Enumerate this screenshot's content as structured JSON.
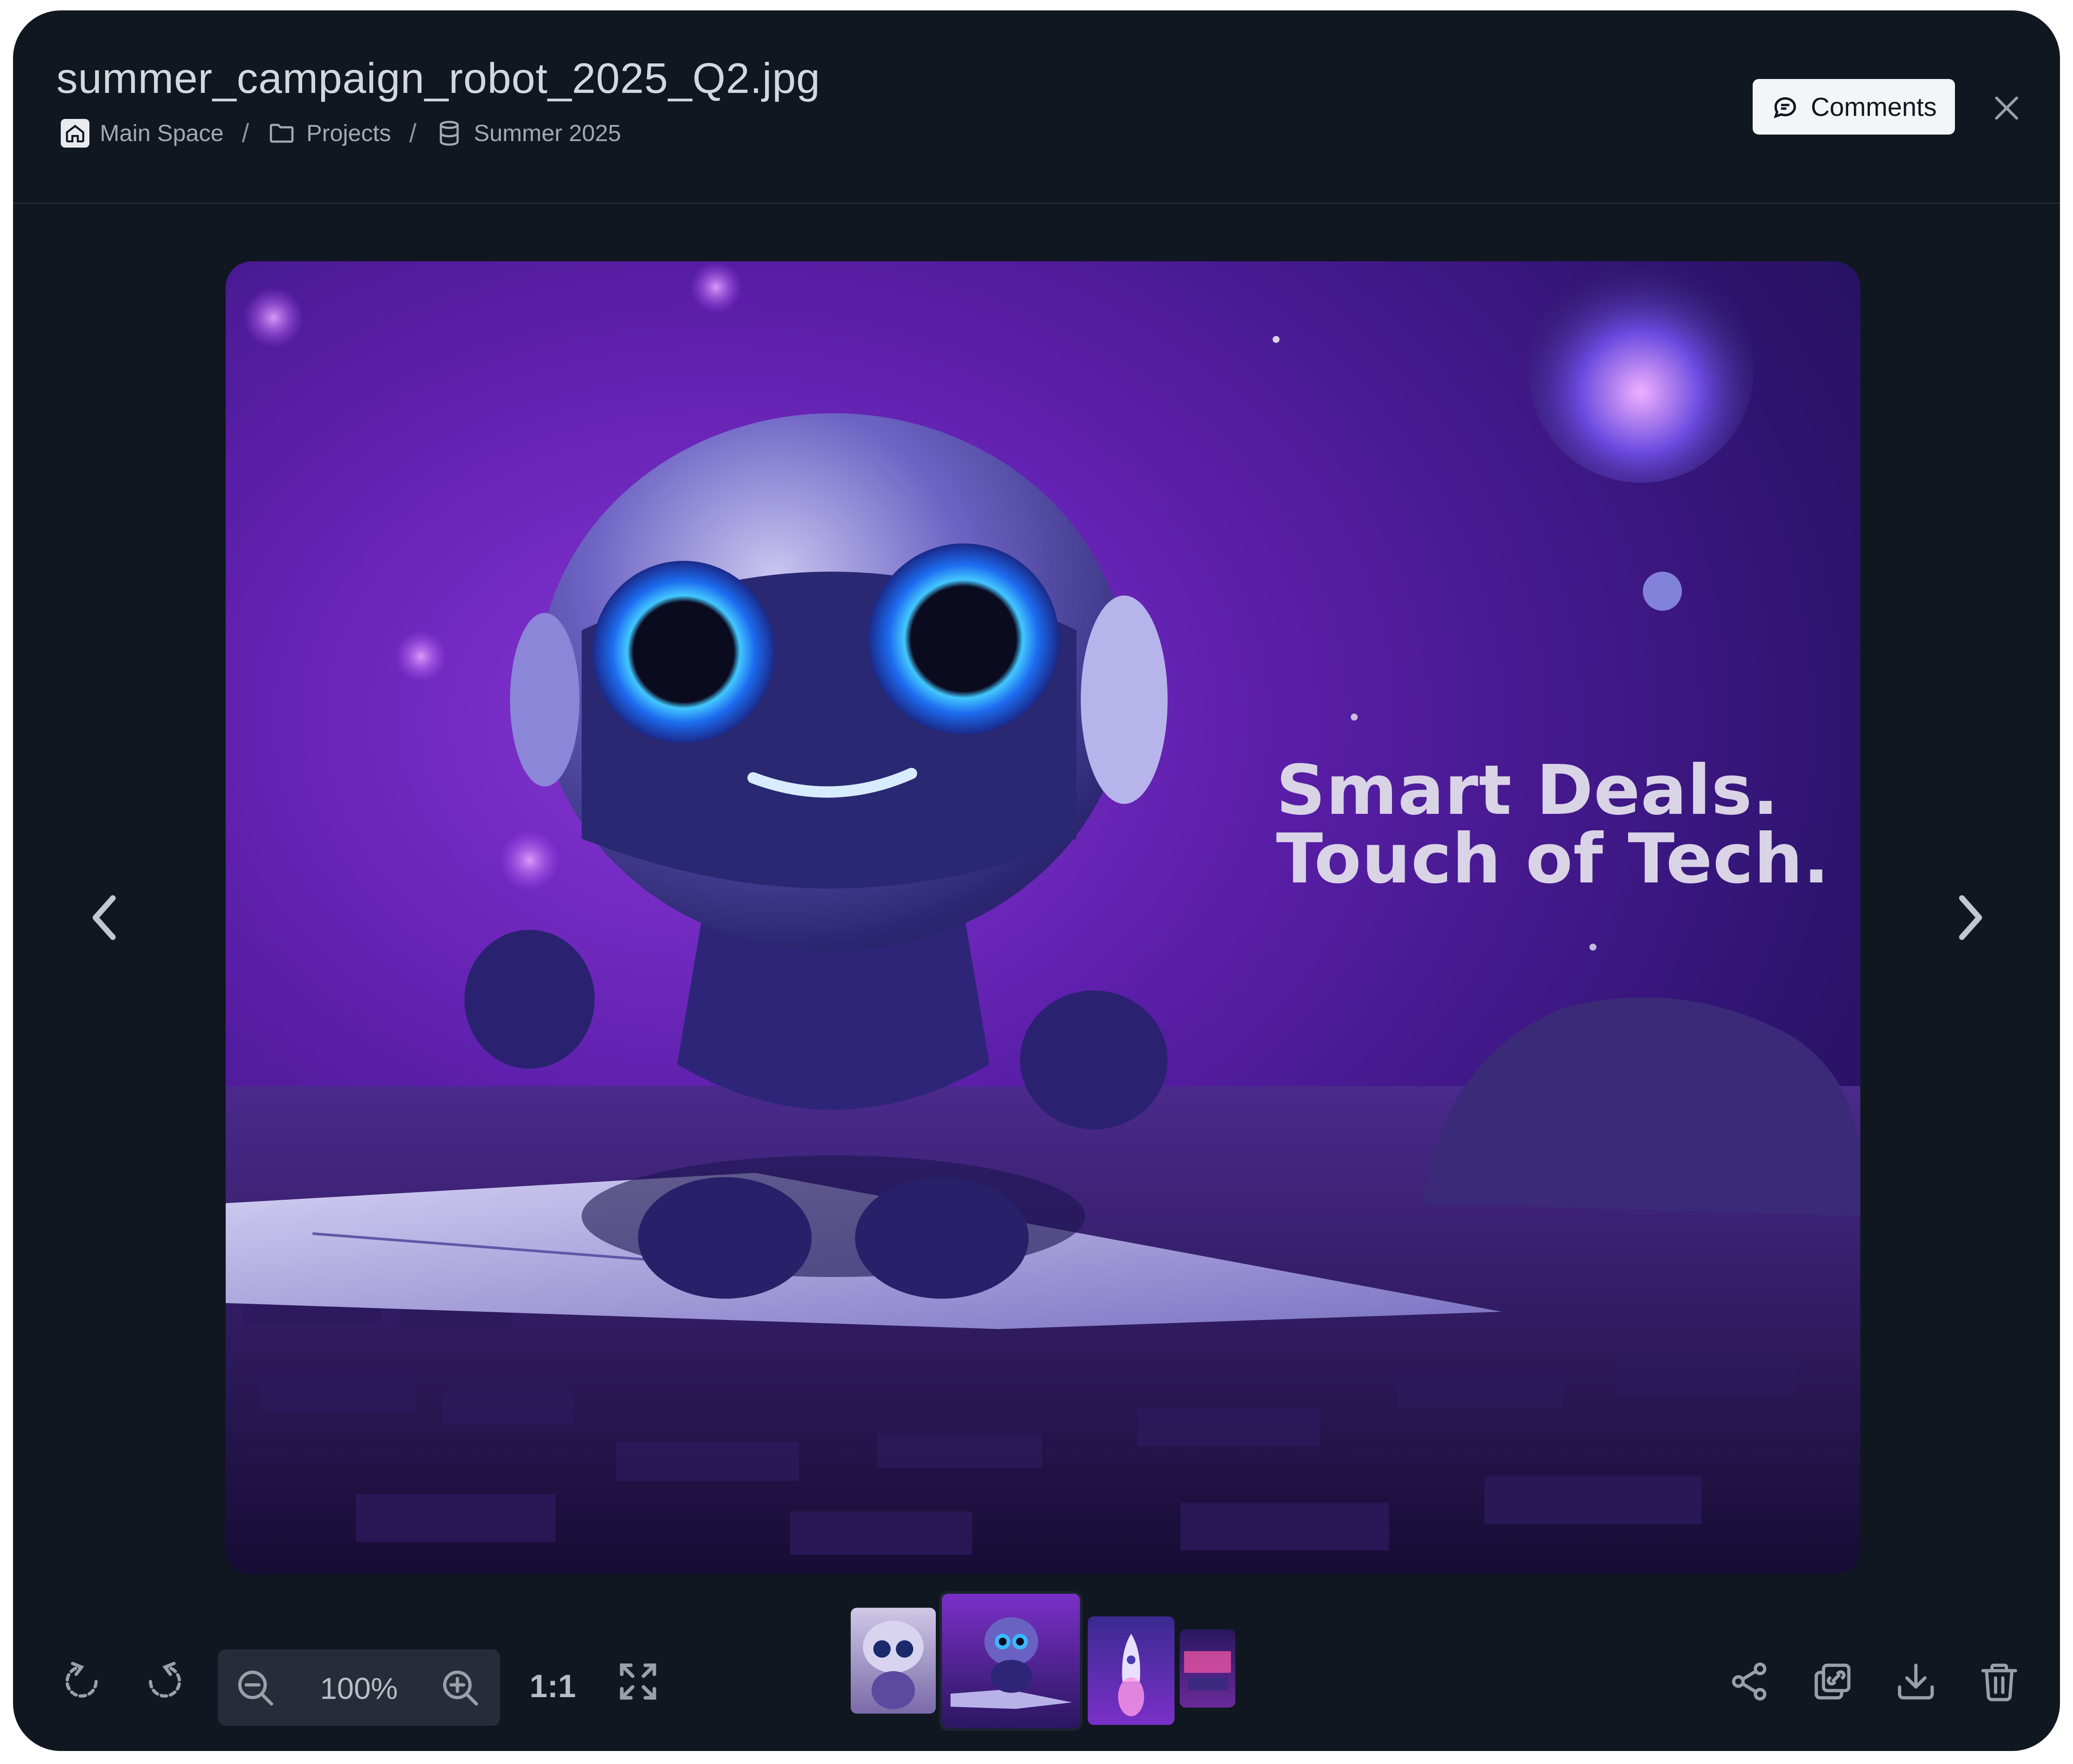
{
  "file": {
    "title": "summer_campaign_robot_2025_Q2.jpg"
  },
  "breadcrumb": [
    {
      "label": "Main Space",
      "icon": "home-icon"
    },
    {
      "label": "Projects",
      "icon": "folder-icon"
    },
    {
      "label": "Summer 2025",
      "icon": "database-icon"
    }
  ],
  "breadcrumb_separator": "/",
  "header": {
    "comments_label": "Comments"
  },
  "image": {
    "headline_line1": "Smart Deals.",
    "headline_line2": "Touch of Tech."
  },
  "toolbar": {
    "zoom_value": "100%",
    "actual_size_label": "1:1",
    "left_tools": [
      "rotate-left-icon",
      "rotate-right-icon",
      "zoom-out-icon",
      "zoom-in-icon",
      "fullscreen-icon"
    ],
    "right_tools": [
      "share-icon",
      "copy-link-icon",
      "download-icon",
      "trash-icon"
    ]
  },
  "thumbnails": [
    {
      "name": "robot-portrait",
      "active": false
    },
    {
      "name": "robot-on-laptop",
      "active": true
    },
    {
      "name": "rocket-launch",
      "active": false
    },
    {
      "name": "neon-room",
      "active": false
    }
  ],
  "colors": {
    "modal_bg": "#111720",
    "accent_purple": "#8a36d8",
    "button_bg": "#f4f5f7"
  }
}
